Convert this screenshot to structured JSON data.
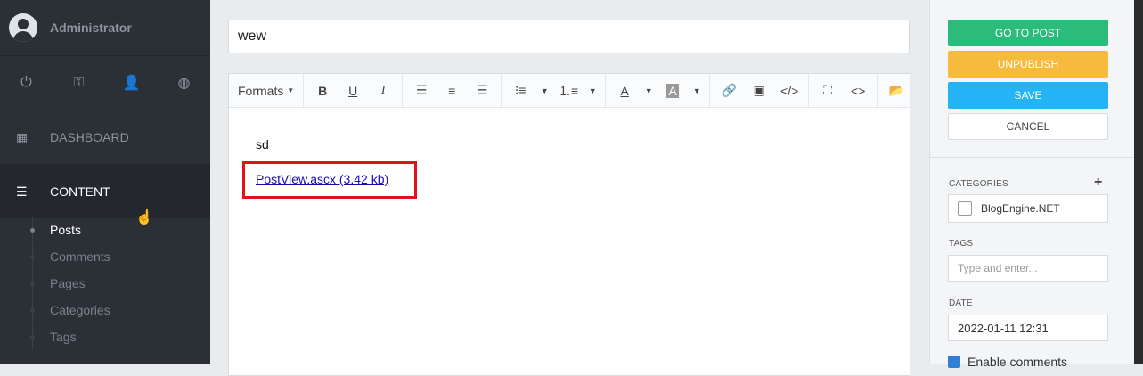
{
  "sidebar": {
    "user": "Administrator",
    "quick_icons": [
      "power-icon",
      "key-icon",
      "user-icon",
      "globe-icon"
    ],
    "nav": {
      "dashboard": "DASHBOARD",
      "content": "CONTENT"
    },
    "sub_items": [
      "Posts",
      "Comments",
      "Pages",
      "Categories",
      "Tags"
    ]
  },
  "editor": {
    "title_value": "wew",
    "formats_label": "Formats",
    "body_text": "sd",
    "attachment_link": "PostView.ascx (3.42 kb)"
  },
  "actions": {
    "go_to_post": "GO TO POST",
    "unpublish": "UNPUBLISH",
    "save": "SAVE",
    "cancel": "CANCEL"
  },
  "panel": {
    "categories_label": "CATEGORIES",
    "category": "BlogEngine.NET",
    "tags_label": "TAGS",
    "tags_placeholder": "Type and enter...",
    "date_label": "DATE",
    "date_value": "2022-01-11 12:31",
    "enable_comments": "Enable comments"
  },
  "colors": {
    "go": "#2bbb7a",
    "unpublish": "#f6bb3d",
    "save": "#24b3f5",
    "highlight": "#e0131a"
  }
}
